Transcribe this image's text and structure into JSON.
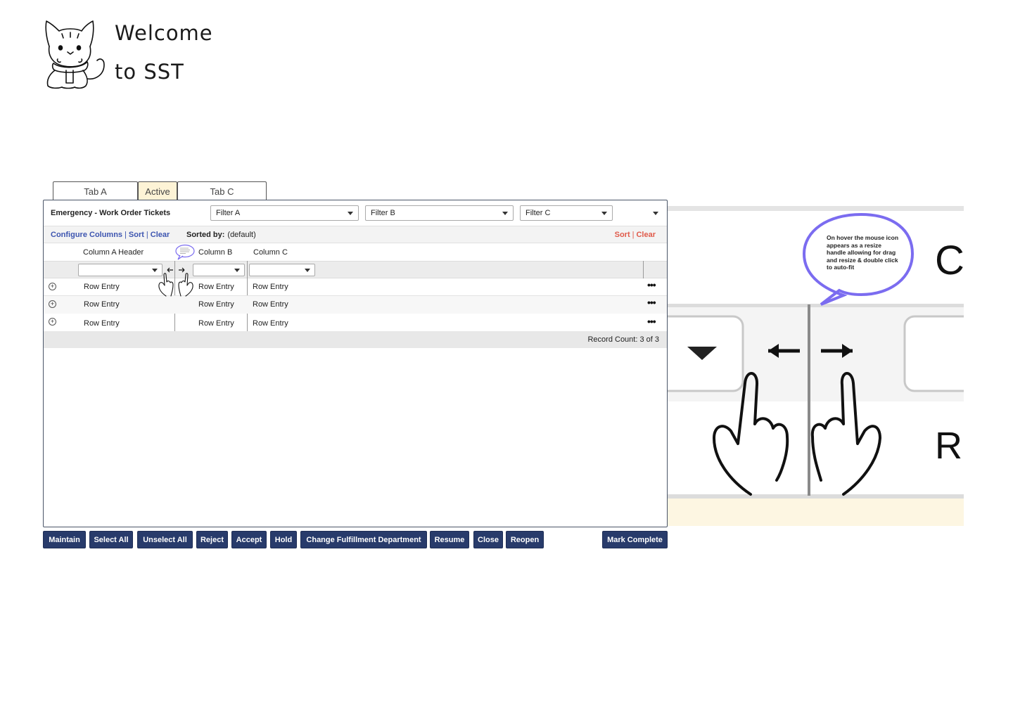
{
  "welcome": {
    "line1": "Welcome",
    "line2": "to SST"
  },
  "tabs": [
    {
      "label": "Tab A"
    },
    {
      "label": "Active"
    },
    {
      "label": "Tab C"
    }
  ],
  "panel": {
    "title": "Emergency - Work Order Tickets",
    "filters": [
      "Filter A",
      "Filter B",
      "Filter C"
    ]
  },
  "toolbar": {
    "configure_columns": "Configure Columns",
    "sort": "Sort",
    "clear": "Clear",
    "sorted_by_label": "Sorted by:",
    "sorted_by_value": "(default)",
    "sort_right": "Sort",
    "clear_right": "Clear",
    "separator": "|"
  },
  "table": {
    "columns": [
      "Column A Header",
      "Column B",
      "Column C"
    ],
    "rows": [
      [
        "Row Entry",
        "Row Entry",
        "Row Entry"
      ],
      [
        "Row Entry",
        "Row Entry",
        "Row Entry"
      ],
      [
        "Row Entry",
        "Row Entry",
        "Row Entry"
      ]
    ],
    "row_menu": "•••",
    "record_count": "Record Count: 3 of 3"
  },
  "actions": {
    "maintain": "Maintain",
    "select_all": "Select All",
    "unselect_all": "Unselect All",
    "reject": "Reject",
    "accept": "Accept",
    "hold": "Hold",
    "change_fulfillment": "Change Fulfillment Department",
    "resume": "Resume",
    "close": "Close",
    "reopen": "Reopen",
    "mark_complete": "Mark Complete"
  },
  "callout": {
    "text": "On hover the mouse icon appears as a resize handle allowing for drag and resize & double click to auto-fit",
    "column_fragment": "C",
    "row_fragment": "R"
  },
  "colors": {
    "button_bg": "#283b6b",
    "link_blue": "#3d55b0",
    "link_red": "#e05a4a",
    "active_tab": "#fdf3d6",
    "bubble_stroke": "#7b6cf0"
  },
  "icons": [
    "cat-illustration",
    "dropdown-caret-icon",
    "expand-plus-icon",
    "more-dots-icon",
    "resize-arrows-icon",
    "hand-pointer-icon",
    "speech-bubble-icon"
  ]
}
